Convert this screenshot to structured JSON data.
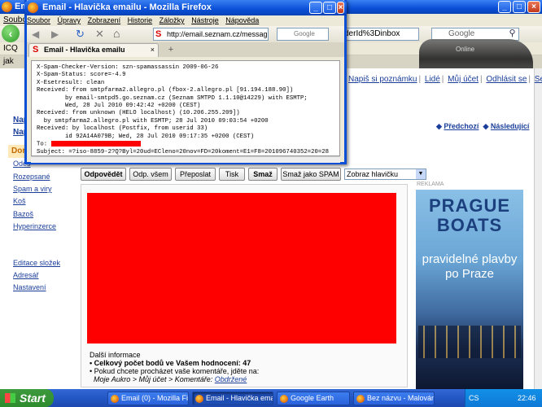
{
  "bg_window": {
    "title": "Email",
    "menu": [
      "Soubor"
    ],
    "url_right": "derId%3Dinbox",
    "search_placeholder": "Google",
    "bookmark_icq": "ICQ",
    "tab_label": "jak",
    "car_ad": "Online",
    "top_links": [
      "Napiš si poznámku",
      "Lidé",
      "Můj účet",
      "Odhlásit se",
      "Seznam"
    ],
    "sidebar_top": [
      "Nap",
      "Nap"
    ],
    "sidebar_dor": "Dor",
    "sidebar_links": [
      "Odes",
      "Rozepsané",
      "Spam a viry",
      "Koš",
      "Bazoš",
      "Hyperinzerce"
    ],
    "sidebar_bottom": [
      "Editace složek",
      "Adresář",
      "Nastavení"
    ],
    "prev_label": "Předchozí",
    "next_label": "Následující",
    "actions": [
      "Odpovědět",
      "Odp. všem",
      "Přeposlat",
      "Tisk",
      "Smaž",
      "Smaž jako SPAM"
    ],
    "header_select": "Zobraz hlavičku",
    "ad_label": "REKLAMA",
    "ad_line1": "PRAGUE",
    "ad_line2": "BOATS",
    "ad_tagline": "pravidelné plavby po Praze",
    "info_title": "Další informace",
    "info_points_prefix": "Celkový počet bodů ve Vašem hodnocení:",
    "info_points": "47",
    "info_line2": "Pokud chcete procházet vaše komentáře, jděte na:",
    "info_path": "Moje Aukro > Můj účet > Komentáře:",
    "info_link": "Obdržené"
  },
  "dialog": {
    "title": "Email - Hlavička emailu - Mozilla Firefox",
    "menu": [
      "Soubor",
      "Úpravy",
      "Zobrazení",
      "Historie",
      "Záložky",
      "Nástroje",
      "Nápověda"
    ],
    "url": "http://email.seznam.cz/messag",
    "search_placeholder": "Google",
    "tab_label": "Email - Hlavička emailu",
    "headers": [
      "X-Spam-Checker-Version: szn-spamassassin 2009-06-26",
      "X-Spam-Status: score=-4.9",
      "X-Esetresult: clean",
      "Received: from smtpfarma2.allegro.pl (fbox-2.allegro.pl [91.194.188.90])",
      "        by email-smtpd5.go.seznam.cz (Seznam SMTPD 1.1.10@14229) with ESMTP;",
      "        Wed, 28 Jul 2010 09:42:42 +0200 (CEST)",
      "Received: from unknown (HELO localhost) (10.206.255.209])",
      "  by smtpfarma2.allegro.pl with ESMTP; 28 Jul 2010 09:03:54 +0200",
      "Received: by localhost (Postfix, from userid 33)",
      "        id 92A14A079B; Wed, 28 Jul 2010 09:17:35 +0200 (CEST)"
    ],
    "to_label": "To:",
    "subject_line": "Subject: =?iso-8859-2?Q?Byl=20ud=ECleno=20nov=FD=20koment=E1=F8=201096740352=20=28"
  },
  "taskbar": {
    "start": "Start",
    "items": [
      "Email (0) - Mozilla Fire...",
      "Email - Hlavička email...",
      "Google Earth",
      "Bez názvu - Malování"
    ],
    "lang": "CS",
    "clock": "22:46"
  }
}
